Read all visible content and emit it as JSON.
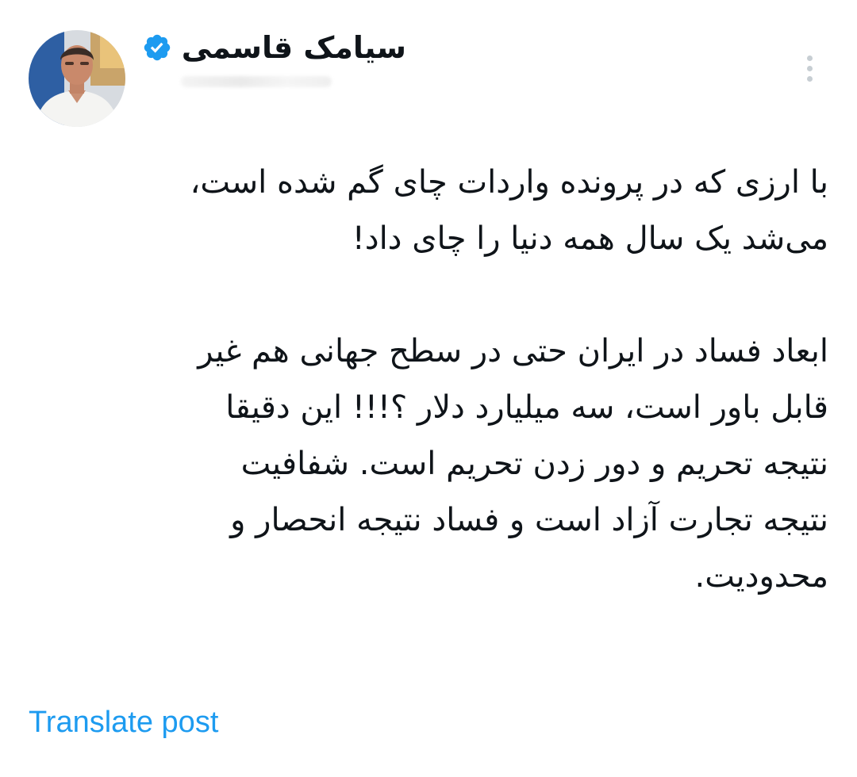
{
  "post": {
    "author": {
      "name": "سیامک قاسمی",
      "verified": true,
      "verified_color": "#1d9bf0",
      "avatar_icon": "profile-photo"
    },
    "more_icon": "more-vertical-icon",
    "paragraph_1": "با ارزی که در پرونده واردات چای گم شده است،\nمی‌شد یک سال همه دنیا را چای داد!",
    "paragraph_2": "ابعاد فساد در ایران حتی در سطح جهانی هم غیر\nقابل باور است، سه میلیارد دلار ؟!!! این دقیقا\nنتیجه تحریم و دور زدن تحریم است. شفافیت\nنتیجه تجارت آزاد است و فساد نتیجه انحصار و\nمحدودیت.",
    "translate_label": "Translate post",
    "translate_color": "#1d9bf0"
  }
}
